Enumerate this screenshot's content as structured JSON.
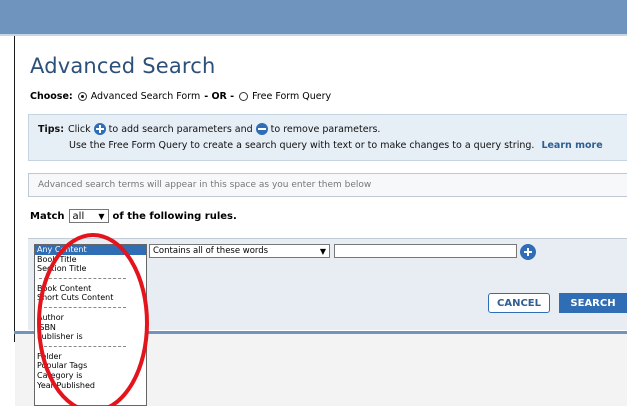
{
  "page": {
    "title": "Advanced Search"
  },
  "choose": {
    "label": "Choose:",
    "option_form": "Advanced Search Form",
    "or_text": "- OR -",
    "option_freeform": "Free Form Query",
    "selected": "Advanced Search Form"
  },
  "tips": {
    "label": "Tips:",
    "click": "Click",
    "add_text": "to add search parameters and",
    "remove_text": "to remove parameters.",
    "line2": "Use the Free Form Query to create a search query with text or to make changes to a query string.",
    "learn_more": "Learn more"
  },
  "terms": {
    "placeholder": "Advanced search terms will appear in this space as you enter them below"
  },
  "match": {
    "label": "Match",
    "value": "all",
    "suffix": "of the following rules."
  },
  "rule": {
    "condition": "Contains all of these words",
    "text_value": "",
    "field_options": {
      "group1": [
        "Any Content",
        "Book Title",
        "Section Title"
      ],
      "group2": [
        "Book Content",
        "Short Cuts Content"
      ],
      "group3": [
        "Author",
        "ISBN",
        "Publisher is"
      ],
      "group4": [
        "Folder",
        "Popular Tags",
        "Category is",
        "Year Published"
      ]
    },
    "selected_field": "Any Content"
  },
  "buttons": {
    "cancel": "CANCEL",
    "search": "SEARCH"
  },
  "icons": {
    "add": "plus-circle-icon",
    "remove": "minus-circle-icon"
  },
  "colors": {
    "header": "#6f94bd",
    "title": "#2d5079",
    "accent": "#2f6db5",
    "tips_bg": "#e6eef6",
    "annotation": "#e3141b"
  }
}
